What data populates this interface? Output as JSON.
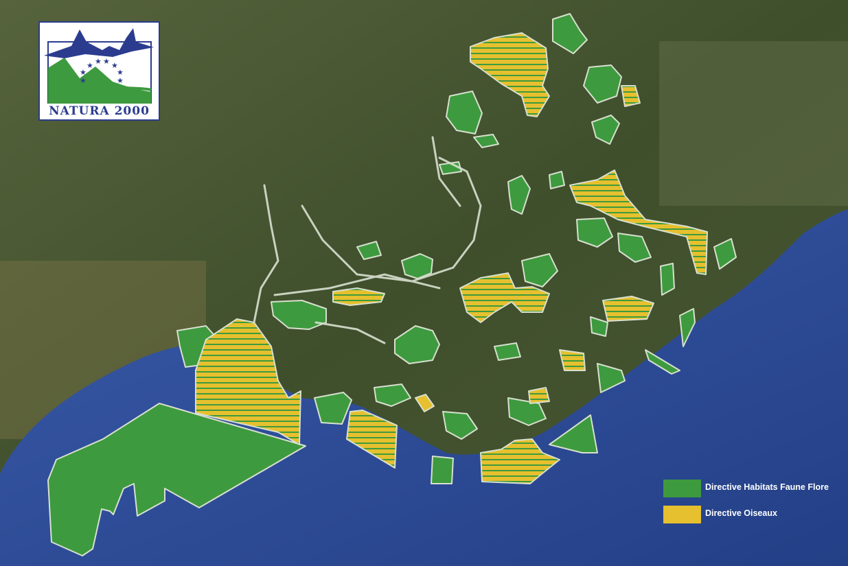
{
  "logo": {
    "text": "NATURA 2000",
    "icon": "natura2000-logo"
  },
  "legend": {
    "items": [
      {
        "label": "Directive Habitats Faune Flore",
        "color": "#3e9a3e"
      },
      {
        "label": "Directive Oiseaux",
        "color": "#e6c02e"
      }
    ]
  },
  "colors": {
    "sea": "#2f4e99",
    "land": "#4c5a34",
    "habitat": "#3e9a3e",
    "birds": "#e6c02e",
    "border": "#d8e0d0"
  }
}
